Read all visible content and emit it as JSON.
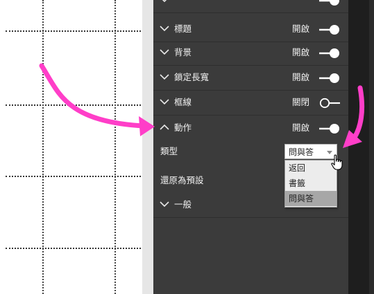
{
  "accent_color": "#ff3ec8",
  "pane": {
    "rows": [
      {
        "label": "",
        "state": "",
        "icon": "chevron-down-icon",
        "toggle": "on"
      },
      {
        "label": "標題",
        "state": "開啟",
        "icon": "chevron-down-icon",
        "toggle": "on"
      },
      {
        "label": "背景",
        "state": "開啟",
        "icon": "chevron-down-icon",
        "toggle": "on"
      },
      {
        "label": "鎖定長寬",
        "state": "開啟",
        "icon": "chevron-down-icon",
        "toggle": "on"
      },
      {
        "label": "框線",
        "state": "關閉",
        "icon": "chevron-down-icon",
        "toggle": "off"
      },
      {
        "label": "動作",
        "state": "開啟",
        "icon": "chevron-up-icon",
        "toggle": "on"
      }
    ],
    "action": {
      "type_label": "類型",
      "reset_label": "還原為預設",
      "select": {
        "value": "問與答",
        "options": [
          "返回",
          "書籤",
          "問與答"
        ],
        "selected_index": 2
      }
    },
    "general": {
      "label": "一般",
      "icon": "chevron-down-icon"
    }
  }
}
